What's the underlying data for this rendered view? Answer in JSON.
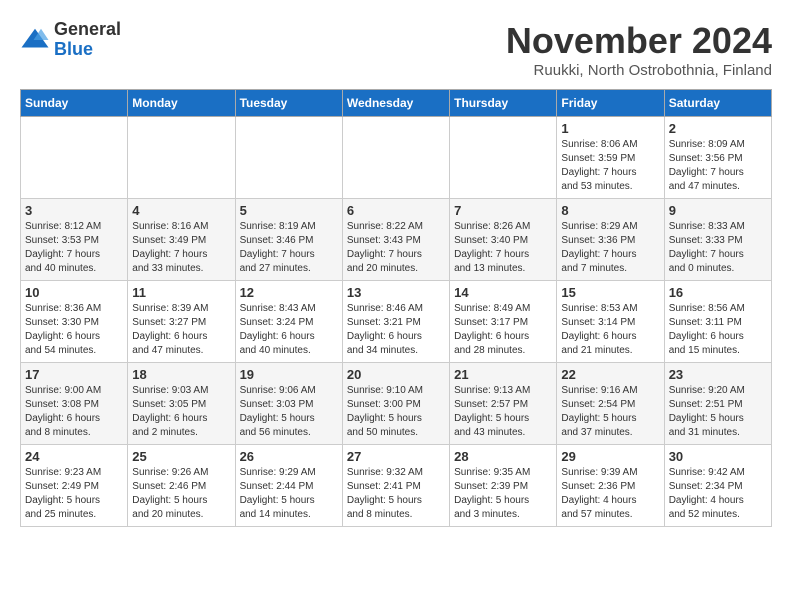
{
  "logo": {
    "general": "General",
    "blue": "Blue"
  },
  "title": "November 2024",
  "location": "Ruukki, North Ostrobothnia, Finland",
  "weekdays": [
    "Sunday",
    "Monday",
    "Tuesday",
    "Wednesday",
    "Thursday",
    "Friday",
    "Saturday"
  ],
  "weeks": [
    [
      {
        "day": "",
        "content": ""
      },
      {
        "day": "",
        "content": ""
      },
      {
        "day": "",
        "content": ""
      },
      {
        "day": "",
        "content": ""
      },
      {
        "day": "",
        "content": ""
      },
      {
        "day": "1",
        "content": "Sunrise: 8:06 AM\nSunset: 3:59 PM\nDaylight: 7 hours\nand 53 minutes."
      },
      {
        "day": "2",
        "content": "Sunrise: 8:09 AM\nSunset: 3:56 PM\nDaylight: 7 hours\nand 47 minutes."
      }
    ],
    [
      {
        "day": "3",
        "content": "Sunrise: 8:12 AM\nSunset: 3:53 PM\nDaylight: 7 hours\nand 40 minutes."
      },
      {
        "day": "4",
        "content": "Sunrise: 8:16 AM\nSunset: 3:49 PM\nDaylight: 7 hours\nand 33 minutes."
      },
      {
        "day": "5",
        "content": "Sunrise: 8:19 AM\nSunset: 3:46 PM\nDaylight: 7 hours\nand 27 minutes."
      },
      {
        "day": "6",
        "content": "Sunrise: 8:22 AM\nSunset: 3:43 PM\nDaylight: 7 hours\nand 20 minutes."
      },
      {
        "day": "7",
        "content": "Sunrise: 8:26 AM\nSunset: 3:40 PM\nDaylight: 7 hours\nand 13 minutes."
      },
      {
        "day": "8",
        "content": "Sunrise: 8:29 AM\nSunset: 3:36 PM\nDaylight: 7 hours\nand 7 minutes."
      },
      {
        "day": "9",
        "content": "Sunrise: 8:33 AM\nSunset: 3:33 PM\nDaylight: 7 hours\nand 0 minutes."
      }
    ],
    [
      {
        "day": "10",
        "content": "Sunrise: 8:36 AM\nSunset: 3:30 PM\nDaylight: 6 hours\nand 54 minutes."
      },
      {
        "day": "11",
        "content": "Sunrise: 8:39 AM\nSunset: 3:27 PM\nDaylight: 6 hours\nand 47 minutes."
      },
      {
        "day": "12",
        "content": "Sunrise: 8:43 AM\nSunset: 3:24 PM\nDaylight: 6 hours\nand 40 minutes."
      },
      {
        "day": "13",
        "content": "Sunrise: 8:46 AM\nSunset: 3:21 PM\nDaylight: 6 hours\nand 34 minutes."
      },
      {
        "day": "14",
        "content": "Sunrise: 8:49 AM\nSunset: 3:17 PM\nDaylight: 6 hours\nand 28 minutes."
      },
      {
        "day": "15",
        "content": "Sunrise: 8:53 AM\nSunset: 3:14 PM\nDaylight: 6 hours\nand 21 minutes."
      },
      {
        "day": "16",
        "content": "Sunrise: 8:56 AM\nSunset: 3:11 PM\nDaylight: 6 hours\nand 15 minutes."
      }
    ],
    [
      {
        "day": "17",
        "content": "Sunrise: 9:00 AM\nSunset: 3:08 PM\nDaylight: 6 hours\nand 8 minutes."
      },
      {
        "day": "18",
        "content": "Sunrise: 9:03 AM\nSunset: 3:05 PM\nDaylight: 6 hours\nand 2 minutes."
      },
      {
        "day": "19",
        "content": "Sunrise: 9:06 AM\nSunset: 3:03 PM\nDaylight: 5 hours\nand 56 minutes."
      },
      {
        "day": "20",
        "content": "Sunrise: 9:10 AM\nSunset: 3:00 PM\nDaylight: 5 hours\nand 50 minutes."
      },
      {
        "day": "21",
        "content": "Sunrise: 9:13 AM\nSunset: 2:57 PM\nDaylight: 5 hours\nand 43 minutes."
      },
      {
        "day": "22",
        "content": "Sunrise: 9:16 AM\nSunset: 2:54 PM\nDaylight: 5 hours\nand 37 minutes."
      },
      {
        "day": "23",
        "content": "Sunrise: 9:20 AM\nSunset: 2:51 PM\nDaylight: 5 hours\nand 31 minutes."
      }
    ],
    [
      {
        "day": "24",
        "content": "Sunrise: 9:23 AM\nSunset: 2:49 PM\nDaylight: 5 hours\nand 25 minutes."
      },
      {
        "day": "25",
        "content": "Sunrise: 9:26 AM\nSunset: 2:46 PM\nDaylight: 5 hours\nand 20 minutes."
      },
      {
        "day": "26",
        "content": "Sunrise: 9:29 AM\nSunset: 2:44 PM\nDaylight: 5 hours\nand 14 minutes."
      },
      {
        "day": "27",
        "content": "Sunrise: 9:32 AM\nSunset: 2:41 PM\nDaylight: 5 hours\nand 8 minutes."
      },
      {
        "day": "28",
        "content": "Sunrise: 9:35 AM\nSunset: 2:39 PM\nDaylight: 5 hours\nand 3 minutes."
      },
      {
        "day": "29",
        "content": "Sunrise: 9:39 AM\nSunset: 2:36 PM\nDaylight: 4 hours\nand 57 minutes."
      },
      {
        "day": "30",
        "content": "Sunrise: 9:42 AM\nSunset: 2:34 PM\nDaylight: 4 hours\nand 52 minutes."
      }
    ]
  ]
}
